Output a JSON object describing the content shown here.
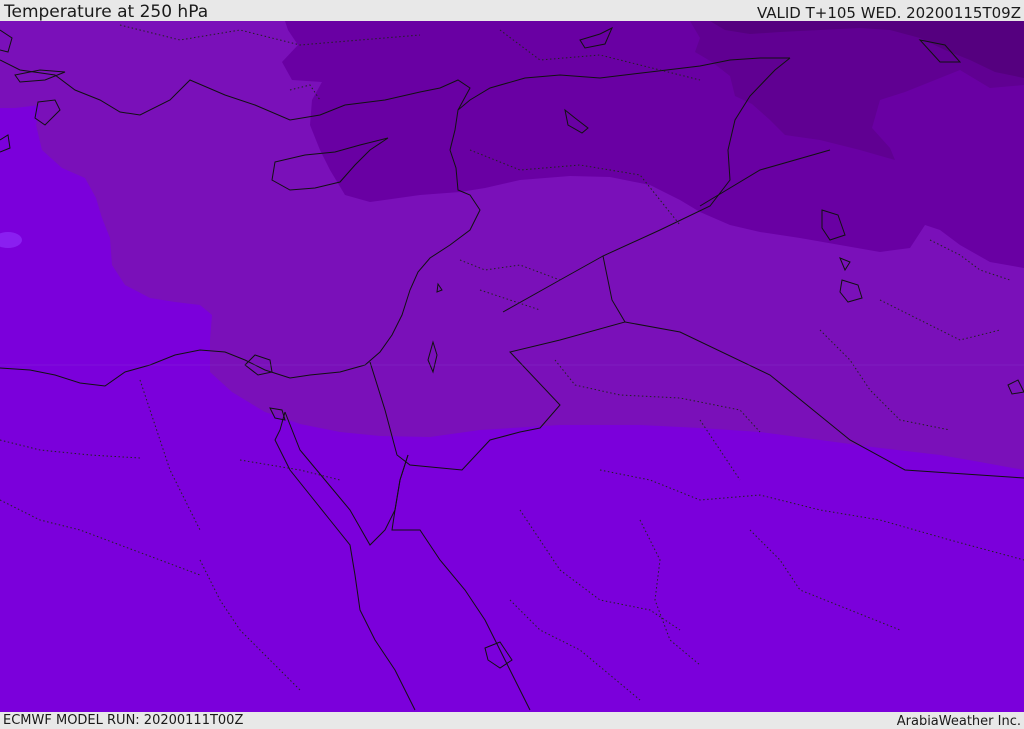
{
  "header": {
    "title": "Temperature at 250 hPa",
    "valid": "VALID T+105 WED. 20200115T09Z"
  },
  "footer": {
    "model_run": "ECMWF MODEL RUN: 20200111T00Z",
    "credit": "ArabiaWeather Inc."
  },
  "map": {
    "colors": {
      "warmest": "#7b00db",
      "warm": "#7a10b9",
      "cool": "#6900a3",
      "cold": "#600092",
      "coldest": "#55007f",
      "border": "#111111"
    }
  }
}
